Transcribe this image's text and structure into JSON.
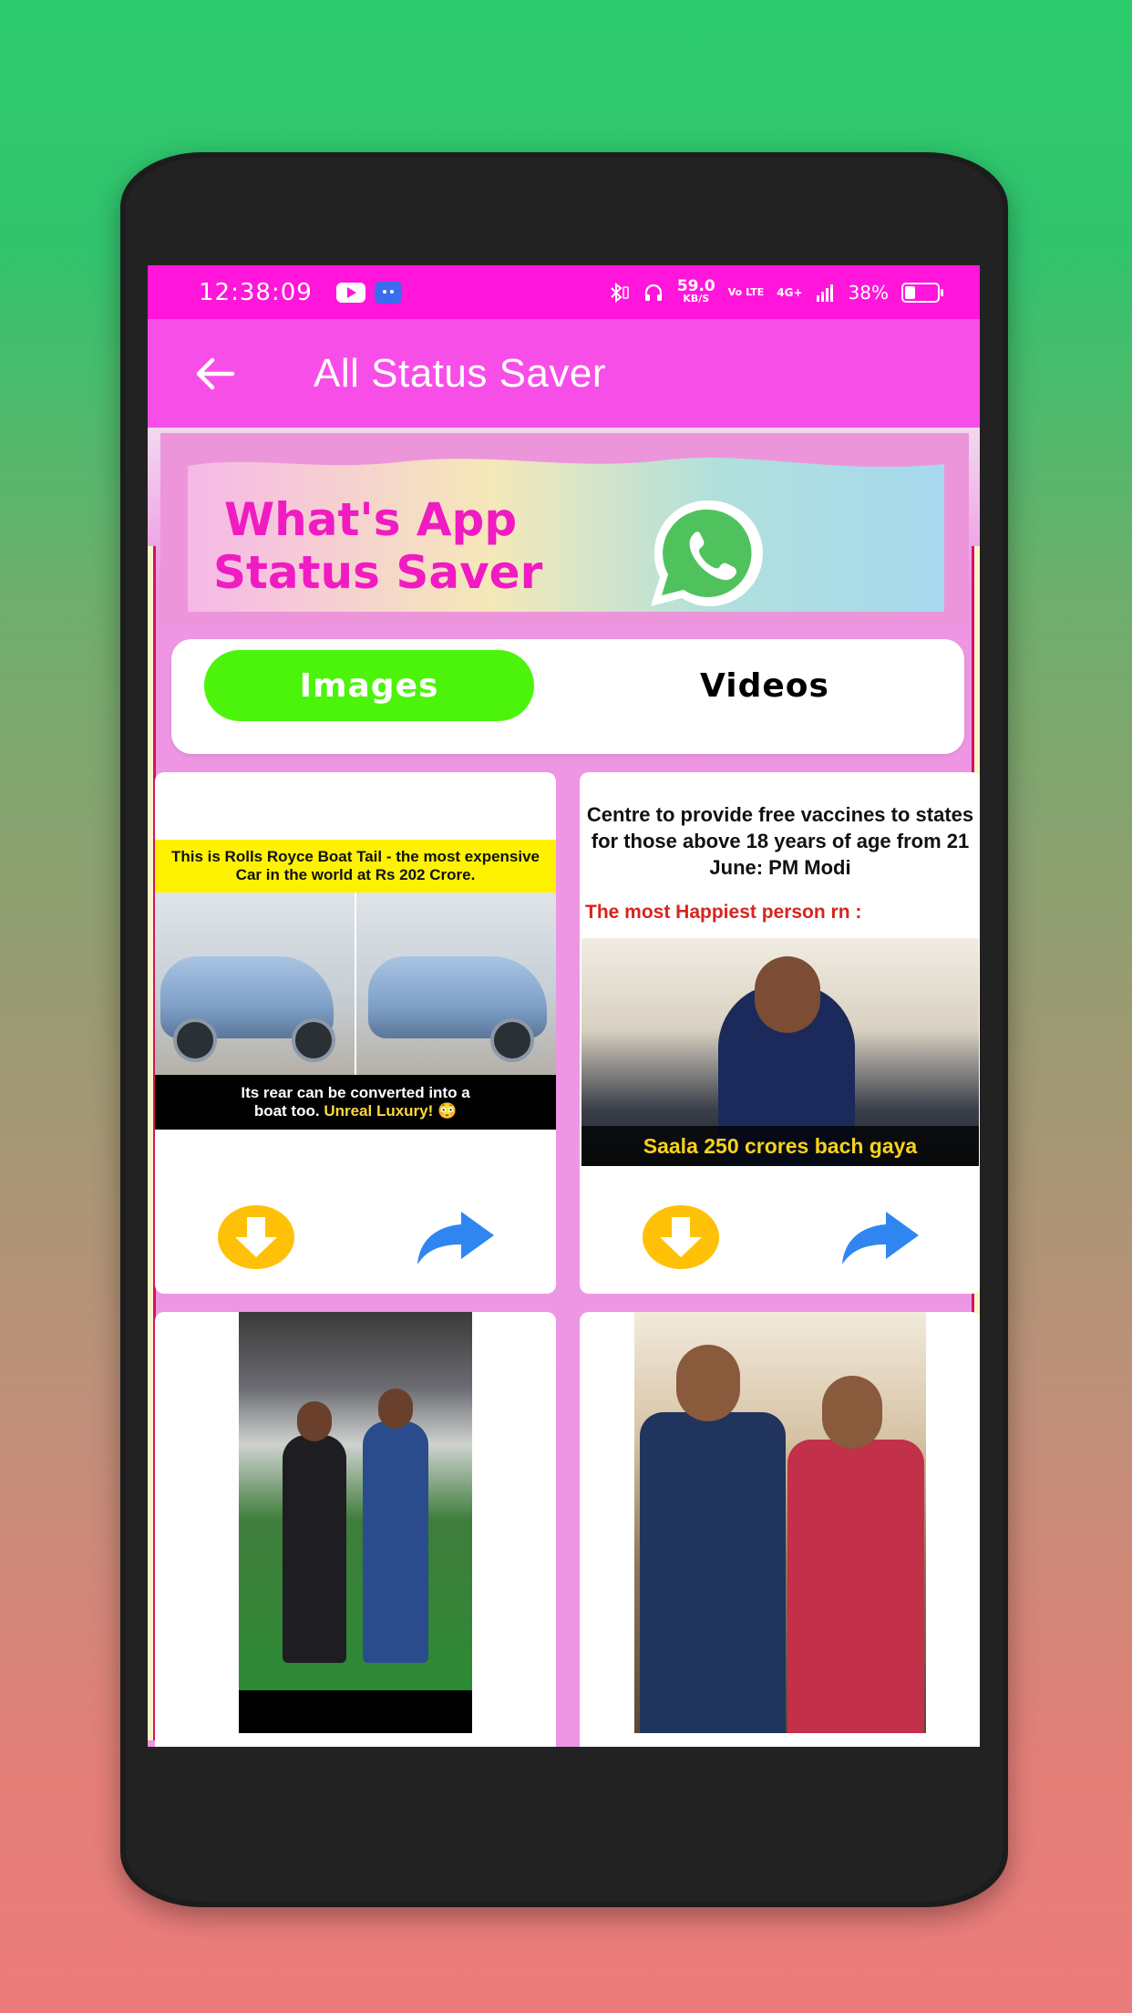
{
  "status_bar": {
    "time": "12:38:09",
    "speed_value": "59.0",
    "speed_unit": "KB/S",
    "volte": "Vo LTE",
    "network": "4G+",
    "battery": "38%"
  },
  "app_bar": {
    "title": "All Status Saver"
  },
  "banner": {
    "line1": "What's App",
    "line2": "Status Saver"
  },
  "tabs": {
    "images": "Images",
    "videos": "Videos",
    "active": "Images"
  },
  "cards": [
    {
      "caption_top": "This is Rolls Royce Boat Tail - the most expensive Car in the world at Rs 202 Crore.",
      "caption_bottom_1": "Its rear can be converted into a",
      "caption_bottom_2": "boat too.",
      "caption_bottom_highlight": "Unreal Luxury! 😳"
    },
    {
      "headline": "Centre to provide free vaccines to states for those above 18 years of age from 21 June: PM Modi",
      "subhead": "The most Happiest person rn :",
      "photo_caption": "Saala 250 crores bach gaya"
    },
    {},
    {}
  ],
  "colors": {
    "status_bar": "#ff16da",
    "app_bar": "#f84ee8",
    "active_tab": "#4cf40c",
    "download_icon": "#ffc107",
    "share_icon": "#2f86f0"
  }
}
